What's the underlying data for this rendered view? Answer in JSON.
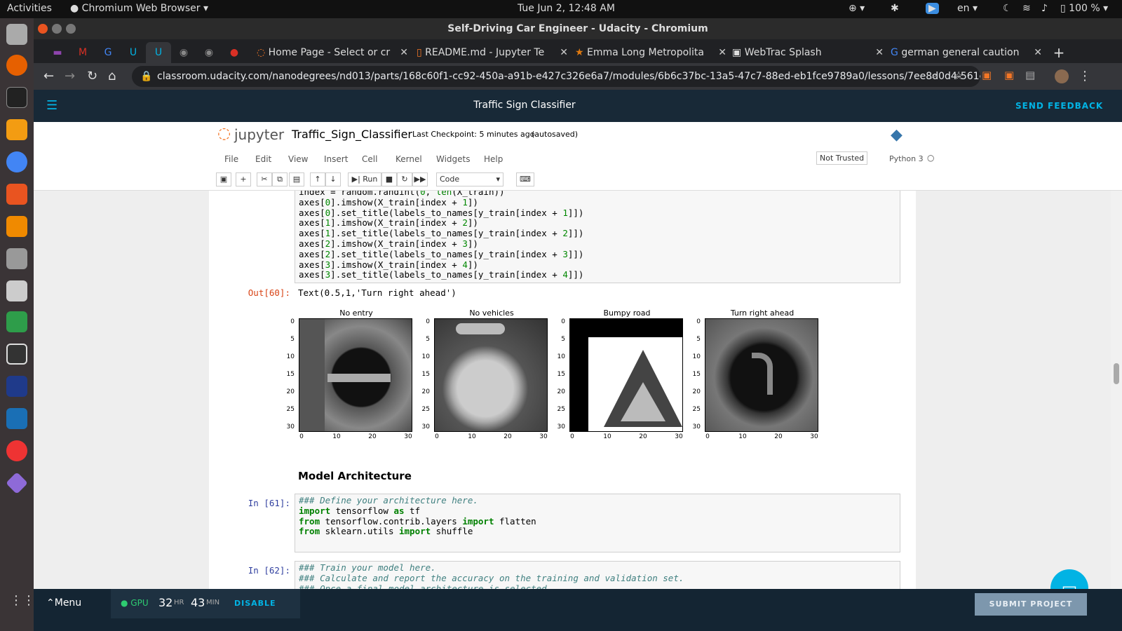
{
  "ubuntu": {
    "activities": "Activities",
    "app_name": "Chromium Web Browser",
    "clock": "Tue Jun  2, 12:48 AM",
    "lang": "en",
    "battery": "100 %"
  },
  "window": {
    "title": "Self-Driving Car Engineer - Udacity - Chromium"
  },
  "tabs": [
    {
      "label": "Home Page - Select or cr"
    },
    {
      "label": "README.md - Jupyter Te"
    },
    {
      "label": "Emma Long Metropolita"
    },
    {
      "label": "WebTrac Splash"
    },
    {
      "label": "german general caution"
    }
  ],
  "address_bar": {
    "url": "classroom.udacity.com/nanodegrees/nd013/parts/168c60f1-cc92-450a-a91b-e427c326e6a7/modules/6b6c37bc-13a5-47c7-88ed-eb1fce9789a0/lessons/7ee8d0d4-561e-4101-..."
  },
  "udacity": {
    "page_title": "Traffic Sign Classifier",
    "feedback": "SEND FEEDBACK"
  },
  "jupyter": {
    "logo_text": "jupyter",
    "notebook_name": "Traffic_Sign_Classifier",
    "checkpoint": "Last Checkpoint: 5 minutes ago",
    "autosaved": "(autosaved)",
    "menu": [
      "File",
      "Edit",
      "View",
      "Insert",
      "Cell",
      "Kernel",
      "Widgets",
      "Help"
    ],
    "not_trusted": "Not Trusted",
    "kernel": "Python 3",
    "run_label": "Run",
    "cell_type": "Code"
  },
  "cells": {
    "out60_prompt": "Out[60]:",
    "out60_text": "Text(0.5,1,'Turn right ahead')",
    "heading": "Model Architecture",
    "in61_prompt": "In [61]:",
    "in62_prompt": "In [62]:"
  },
  "figures": [
    {
      "title": "No entry"
    },
    {
      "title": "No vehicles"
    },
    {
      "title": "Bumpy road"
    },
    {
      "title": "Turn right ahead"
    }
  ],
  "axis_ticks": {
    "y": [
      "0",
      "5",
      "10",
      "15",
      "20",
      "25",
      "30"
    ],
    "x": [
      "0",
      "10",
      "20",
      "30"
    ]
  },
  "bottom": {
    "menu": "Menu",
    "gpu": "GPU",
    "hours": "32",
    "hr_unit": "HR",
    "minutes": "43",
    "min_unit": "MIN",
    "disable": "DISABLE",
    "submit": "SUBMIT PROJECT"
  }
}
